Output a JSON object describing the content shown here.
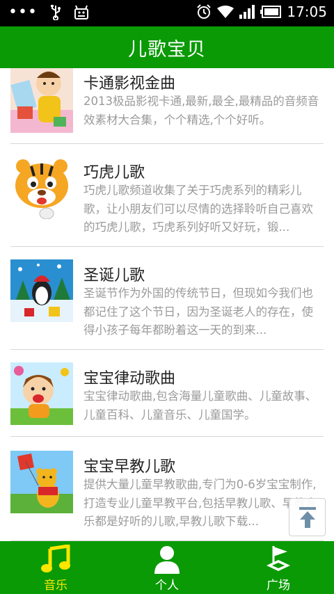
{
  "status_bar": {
    "time": "17:05",
    "icons": [
      "more-dots-icon",
      "usb-icon",
      "android-debug-icon",
      "alarm-icon",
      "wifi-icon",
      "signal-icon",
      "battery-icon"
    ]
  },
  "header": {
    "title": "儿歌宝贝"
  },
  "list": {
    "items": [
      {
        "title": "卡通影视金曲",
        "desc": "2013极品影视卡通,最新,最全,最精品的音频音效素材大合集，个个精选,个个好听。",
        "thumb": "cartoon-boy-thumbnail"
      },
      {
        "title": "巧虎儿歌",
        "desc": "巧虎儿歌频道收集了关于巧虎系列的精彩儿歌，让小朋友们可以尽情的选择聆听自己喜欢的巧虎儿歌，巧虎系列好听又好玩，锻...",
        "thumb": "tiger-thumbnail"
      },
      {
        "title": "圣诞儿歌",
        "desc": "圣诞节作为外国的传统节日，但现如今我们也都记住了这个节日，因为圣诞老人的存在，使得小孩子每年都盼着这一天的到来...",
        "thumb": "christmas-penguin-thumbnail"
      },
      {
        "title": "宝宝律动歌曲",
        "desc": "宝宝律动歌曲,包含海量儿童歌曲、儿童故事、儿童百科、儿童音乐、儿童国学。",
        "thumb": "happy-child-thumbnail"
      },
      {
        "title": "宝宝早教儿歌",
        "desc": "提供大量儿童早教歌曲,专门为0-6岁宝宝制作,打造专业儿童早教平台,包括早教儿歌、早教音乐都是好听的儿歌,早教儿歌下载...",
        "thumb": "pooh-kite-thumbnail"
      }
    ]
  },
  "bottom_nav": {
    "items": [
      {
        "label": "音乐",
        "icon": "music-note-icon",
        "active": true
      },
      {
        "label": "个人",
        "icon": "person-icon",
        "active": false
      },
      {
        "label": "广场",
        "icon": "plaza-flag-icon",
        "active": false
      }
    ]
  },
  "colors": {
    "primary": "#0a9a05",
    "active_tab": "#ffe600",
    "desc_text": "#9a9a9a"
  }
}
